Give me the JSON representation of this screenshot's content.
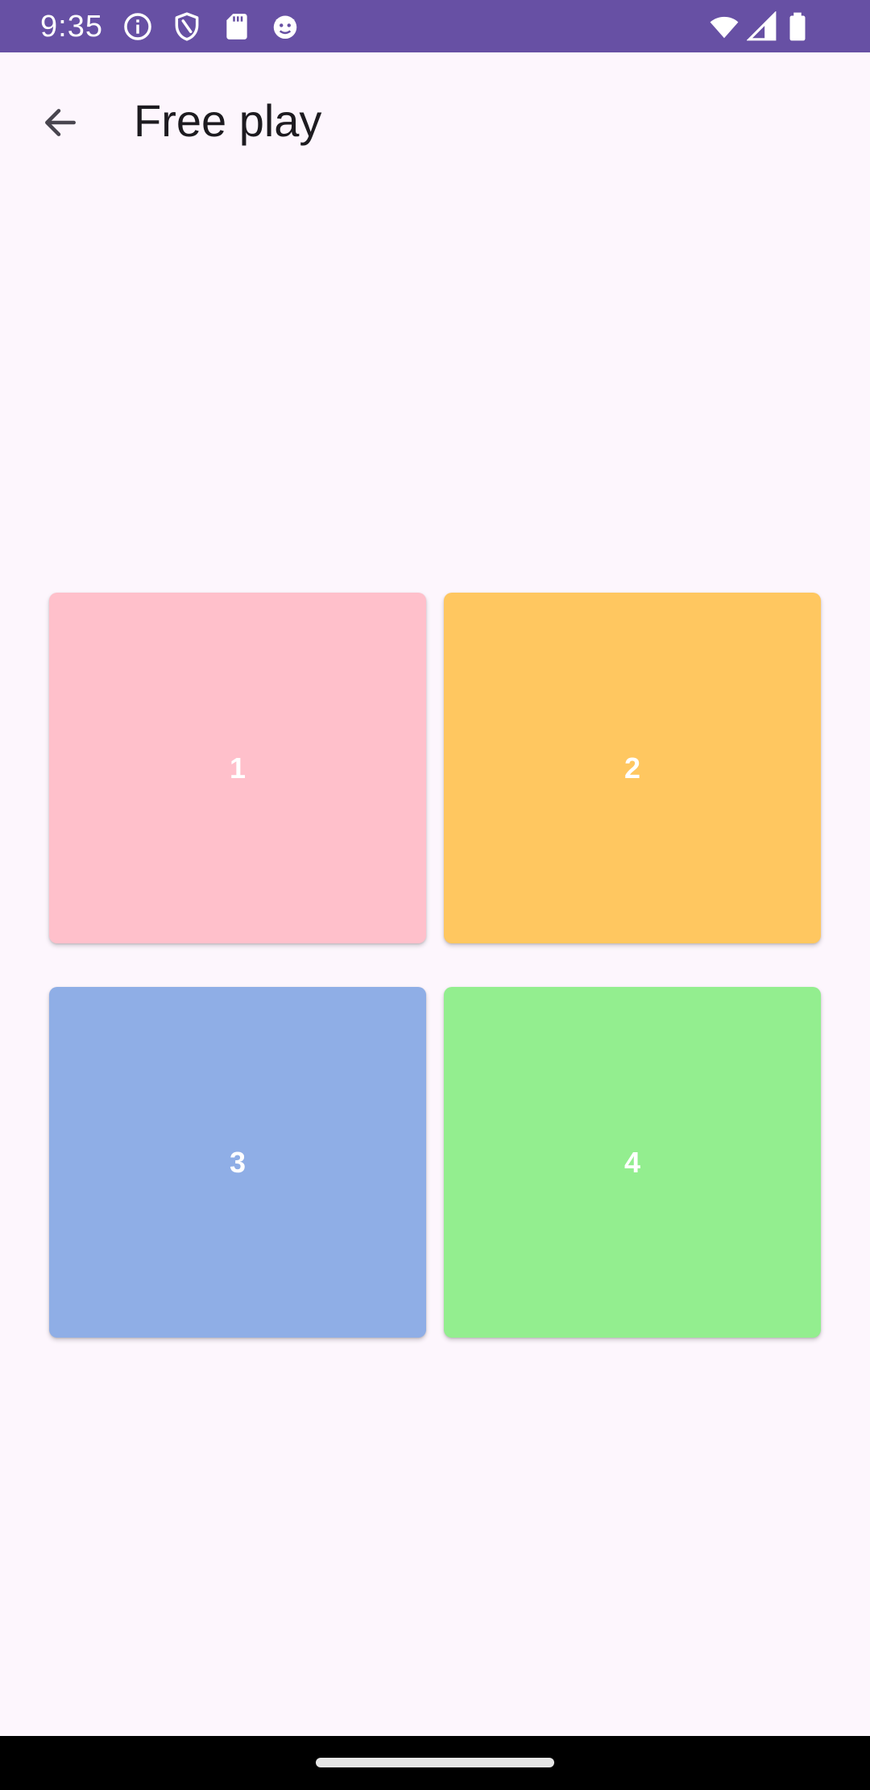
{
  "status_bar": {
    "time": "9:35",
    "background": "#6750a4",
    "left_icons": [
      "info-icon",
      "shield-icon",
      "sd-card-icon",
      "cat-face-icon"
    ],
    "right_icons": [
      "wifi-icon",
      "signal-icon",
      "battery-icon"
    ]
  },
  "app_bar": {
    "back_icon": "arrow-back-icon",
    "title": "Free play"
  },
  "tiles": [
    {
      "label": "1",
      "color": "#ffc0cb"
    },
    {
      "label": "2",
      "color": "#ffc760"
    },
    {
      "label": "3",
      "color": "#8faee6"
    },
    {
      "label": "4",
      "color": "#93ee8f"
    }
  ],
  "nav_bar": {
    "handle": "home-gesture-handle"
  }
}
